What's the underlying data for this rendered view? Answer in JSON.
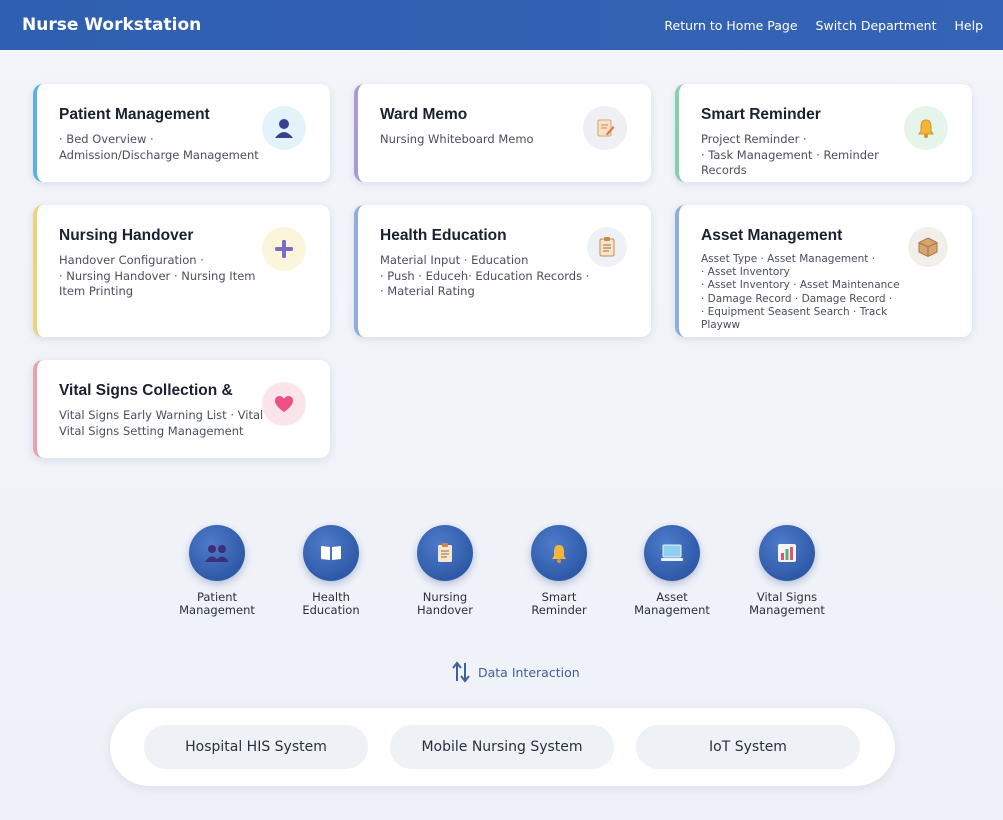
{
  "header": {
    "title": "Nurse Workstation",
    "nav": [
      "Return to Home Page",
      "Switch Department",
      "Help"
    ]
  },
  "cards": [
    {
      "title": "Patient Management",
      "desc": "· Bed Overview ·\nAdmission/Discharge Management",
      "icon": "user-icon",
      "accent": "#5bb3dc"
    },
    {
      "title": "Ward Memo",
      "desc": "Nursing Whiteboard Memo",
      "icon": "memo-icon",
      "accent": "#a99ad6"
    },
    {
      "title": "Smart Reminder",
      "desc": "Project Reminder ·\n· Task Management · Reminder Records",
      "icon": "bell-icon",
      "accent": "#86cfae"
    },
    {
      "title": "Nursing Handover",
      "desc": "Handover Configuration ·\n· Nursing Handover · Nursing Item\nItem Printing",
      "icon": "plus-icon",
      "accent": "#ecd27a"
    },
    {
      "title": "Health Education",
      "desc": "Material Input · Education\n· Push · Educeh· Education Records ·\n· Material Rating",
      "icon": "clipboard-icon",
      "accent": "#8eaee0"
    },
    {
      "title": "Asset Management",
      "desc": "Asset Type · Asset Management ·\n· Asset Inventory\n· Asset Inventory · Asset Maintenance\n· Damage Record · Damage Record ·\n· Equipment Seasent Search · Track Playww",
      "icon": "box-icon",
      "accent": "#8eaee0"
    },
    {
      "title": "Vital Signs Collection &",
      "desc": "Vital Signs Early Warning List · Vital\nVital Signs Setting Management",
      "icon": "heart-icon",
      "accent": "#e6a3ad"
    }
  ],
  "modules": [
    {
      "label": "Patient\nManagement",
      "icon": "users-icon"
    },
    {
      "label": "Health\nEducation",
      "icon": "book-icon"
    },
    {
      "label": "Nursing\nHandover",
      "icon": "clipboard-icon"
    },
    {
      "label": "Smart\nReminder",
      "icon": "bell-icon"
    },
    {
      "label": "Asset\nManagement",
      "icon": "monitor-icon"
    },
    {
      "label": "Vital Signs\nManagement",
      "icon": "chart-icon"
    }
  ],
  "interaction": {
    "label": "Data Interaction",
    "icon": "swap-arrows-icon"
  },
  "systems": [
    "Hospital HIS System",
    "Mobile Nursing System",
    "IoT System"
  ]
}
